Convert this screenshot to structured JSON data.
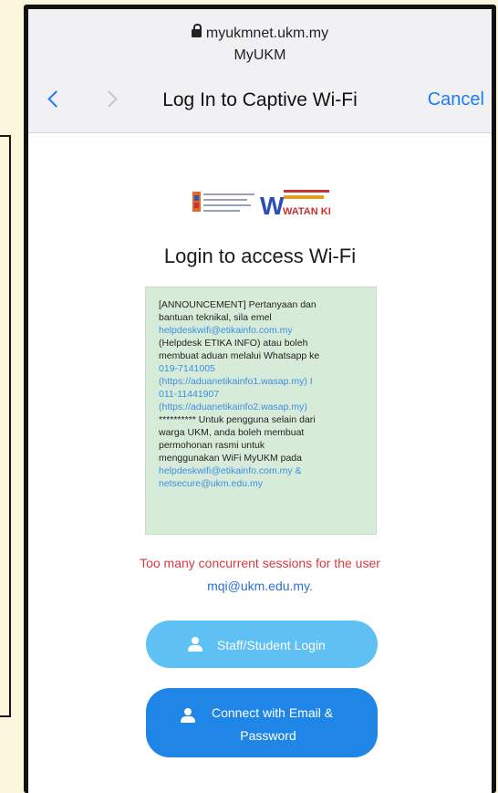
{
  "browser": {
    "url": "myukmnet.ukm.my",
    "site_name": "MyUKM",
    "title": "Log In to Captive Wi-Fi",
    "cancel_label": "Cancel"
  },
  "page": {
    "heading": "Login to access Wi-Fi",
    "logo_wk_top": "WATAN KITA"
  },
  "announcement": {
    "lines": [
      "[ANNOUNCEMENT] Pertanyaan dan",
      "bantuan teknikal, sila emel",
      "helpdeskwifi@etikainfo.com.my",
      "(Helpdesk ETIKA INFO) atau boleh",
      "membuat aduan melalui Whatsapp ke",
      "019-7141005",
      "(https://aduanetikainfo1.wasap.my) I",
      "011-11441907",
      "(https://aduanetikainfo2.wasap.my)",
      "********** Untuk pengguna selain dari",
      "warga UKM, anda boleh membuat",
      "permohonan rasmi untuk",
      "menggunakan WiFi MyUKM pada",
      "helpdeskwifi@etikainfo.com.my &",
      "netsecure@ukm.edu.my"
    ]
  },
  "error": {
    "line1": "Too many concurrent sessions for the user",
    "line2": "mqi@ukm.edu.my."
  },
  "buttons": {
    "staff_login": "Staff/Student Login",
    "email_line1": "Connect with Email &",
    "email_line2": "Password"
  },
  "colors": {
    "accent": "#1a7cf5",
    "error": "#d93a3a",
    "announcement_bg": "#d7ecd8",
    "staff_button": "#5ec0f3",
    "email_button": "#1f86e8"
  }
}
